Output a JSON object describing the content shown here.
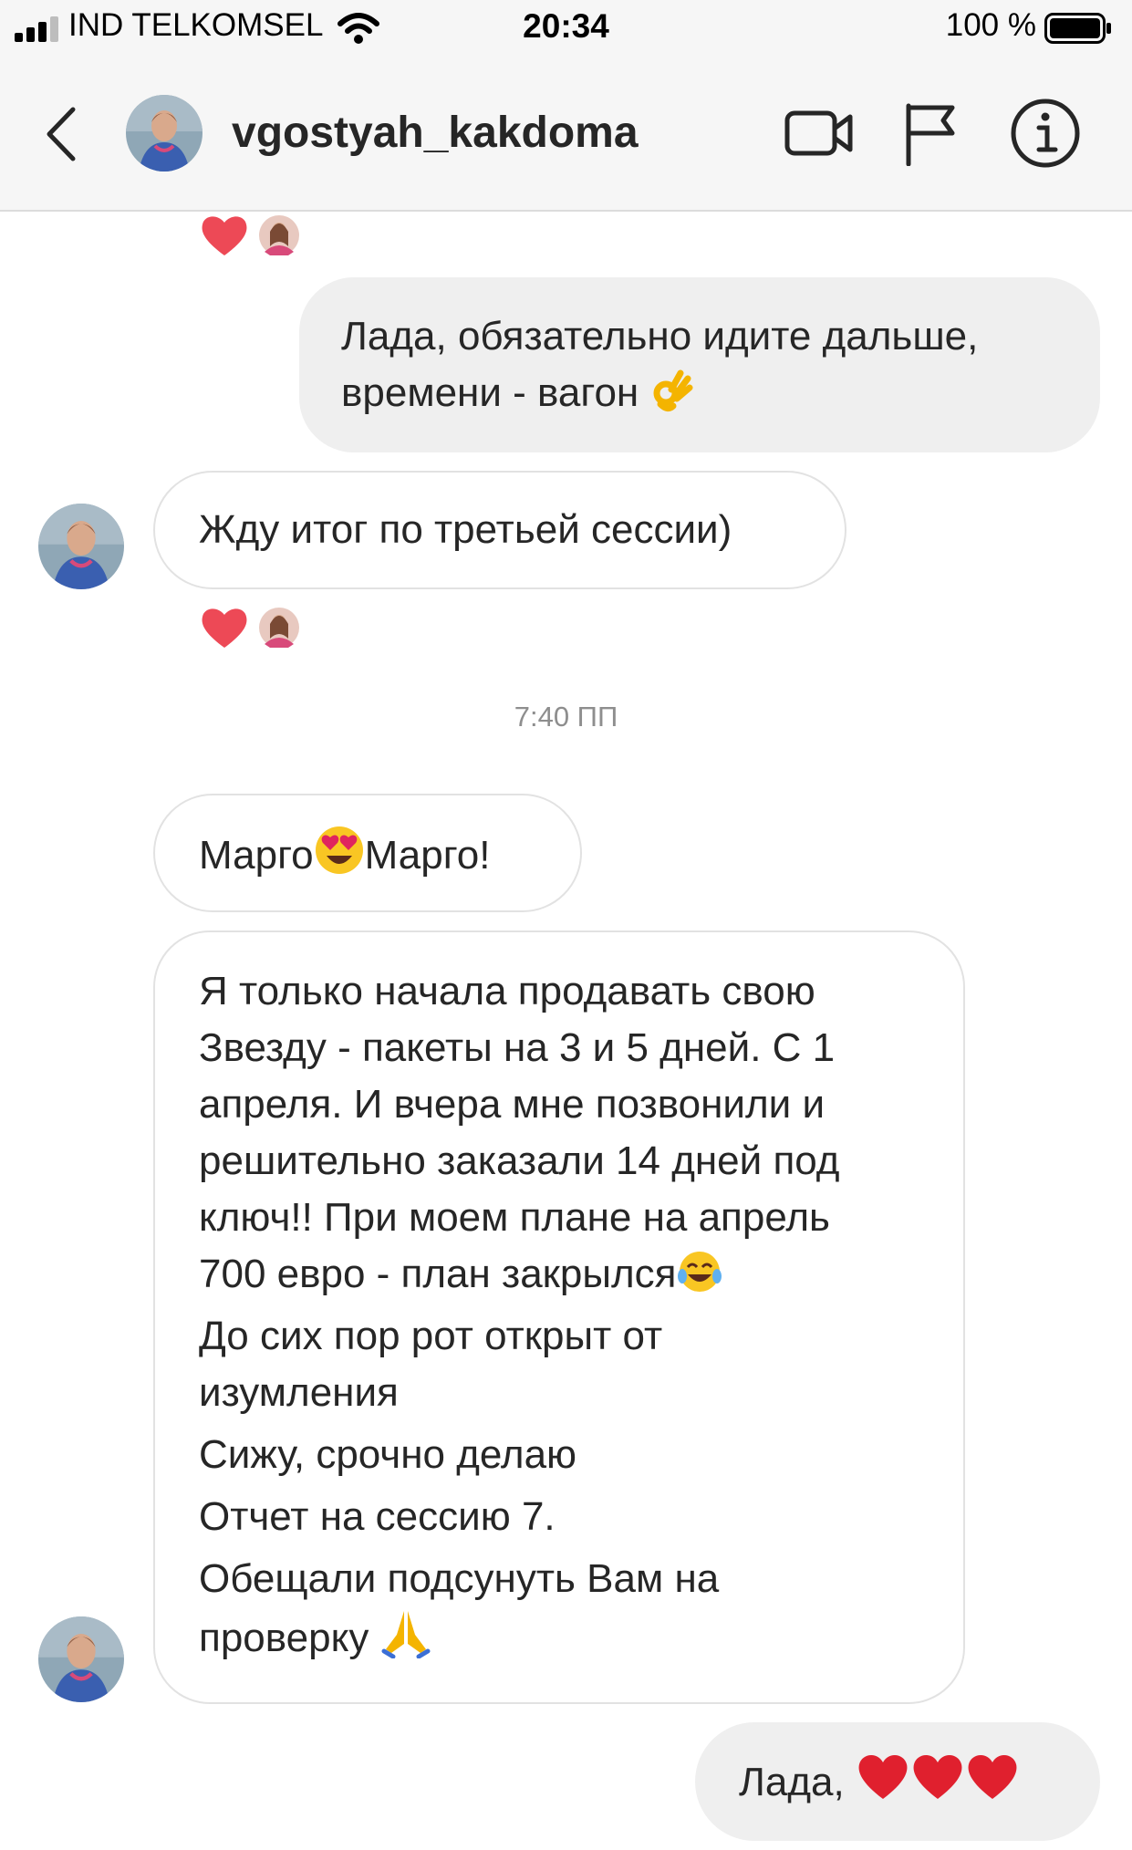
{
  "status_bar": {
    "carrier": "IND TELKOMSEL",
    "time": "20:34",
    "battery_text": "100 %"
  },
  "header": {
    "username": "vgostyah_kakdoma",
    "icons": [
      "back-arrow-icon",
      "video-call-icon",
      "flag-icon",
      "info-icon"
    ]
  },
  "messages": [
    {
      "side": "outgoing",
      "lines": [
        "Лада, обязательно идите дальше,",
        "времени - вагон"
      ],
      "emoji": "ok-hand"
    },
    {
      "side": "incoming",
      "lines": [
        "Жду итог по третьей сессии)"
      ]
    },
    {
      "side": "incoming",
      "lines": [
        "Марго",
        "Марго!"
      ],
      "emoji": "heart-eyes"
    },
    {
      "side": "incoming",
      "lines": [
        "Я только начала продавать свою",
        "Звезду - пакеты на 3 и 5 дней. С 1",
        "апреля. И вчера мне позвонили и",
        "решительно заказали 14 дней под",
        "ключ!! При моем плане на апрель",
        "700 евро - план закрылся",
        "До сих пор рот открыт от",
        "изумления",
        "Сижу, срочно делаю",
        "Отчет на сессию 7.",
        "Обещали подсунуть Вам на",
        "проверку"
      ]
    },
    {
      "side": "outgoing",
      "lines": [
        "Лада,"
      ],
      "emoji": "hearts"
    }
  ],
  "timestamp": "7:40 ПП",
  "colors": {
    "bubble_outgoing": "#efefef",
    "bubble_border": "#e2e2e2",
    "heart": "#ed4956",
    "header_bg": "#f6f6f6"
  }
}
